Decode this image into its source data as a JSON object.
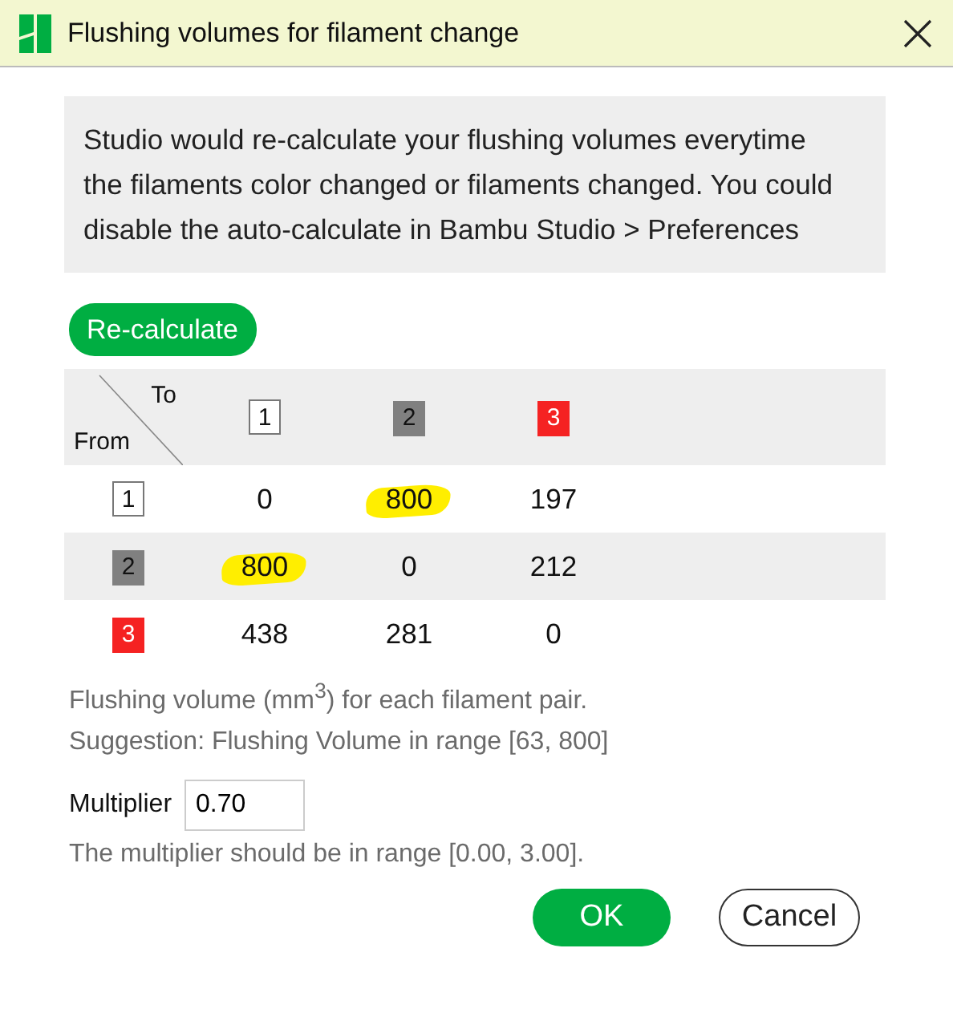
{
  "window": {
    "title": "Flushing volumes for filament change"
  },
  "info": "Studio would re-calculate your flushing volumes everytime the filaments color changed or filaments changed. You could disable the auto-calculate in Bambu Studio > Preferences",
  "recalculate_button": "Re-calculate",
  "table": {
    "corner_to": "To",
    "corner_from": "From",
    "filaments": [
      {
        "label": "1",
        "color": "#ffffff"
      },
      {
        "label": "2",
        "color": "#808080"
      },
      {
        "label": "3",
        "color": "#f52222"
      }
    ],
    "rows": [
      {
        "filament": {
          "label": "1",
          "color": "#ffffff"
        },
        "cells": [
          {
            "value": "0",
            "highlighted": false
          },
          {
            "value": "800",
            "highlighted": true
          },
          {
            "value": "197",
            "highlighted": false
          }
        ]
      },
      {
        "filament": {
          "label": "2",
          "color": "#808080"
        },
        "cells": [
          {
            "value": "800",
            "highlighted": true
          },
          {
            "value": "0",
            "highlighted": false
          },
          {
            "value": "212",
            "highlighted": false
          }
        ]
      },
      {
        "filament": {
          "label": "3",
          "color": "#f52222"
        },
        "cells": [
          {
            "value": "438",
            "highlighted": false
          },
          {
            "value": "281",
            "highlighted": false
          },
          {
            "value": "0",
            "highlighted": false
          }
        ]
      }
    ]
  },
  "note": "Flushing volume (mm$^{3}$) for each filament pair.",
  "suggestion": "Suggestion: Flushing Volume in range [63, 800]",
  "multiplier": {
    "label": "Multiplier",
    "value": "0.70"
  },
  "multiplier_hint": "The multiplier should be in range [0.00, 3.00].",
  "buttons": [
    {
      "label": "OK",
      "kind": "primary"
    },
    {
      "label": "Cancel",
      "kind": "secondary"
    }
  ]
}
